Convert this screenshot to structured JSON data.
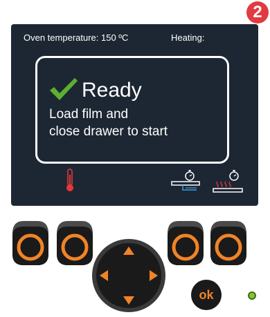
{
  "step_badge": "2",
  "screen": {
    "oven_temperature_label": "Oven temperature: 150 ºC",
    "heating_label": "Heating:",
    "status": {
      "title": "Ready",
      "line1": "Load film and",
      "line2": "close drawer to start"
    },
    "icons": [
      "thermometer-icon",
      "timer-drawer-icon",
      "timer-heating-icon"
    ]
  },
  "controls": {
    "soft_keys": [
      "soft-key-1",
      "soft-key-2",
      "soft-key-3",
      "soft-key-4"
    ],
    "nav_pad": [
      "up-arrow",
      "down-arrow",
      "left-arrow",
      "right-arrow"
    ],
    "ok_label": "ok",
    "led_color": "#86c533"
  },
  "colors": {
    "screen_bg": "#1d2733",
    "accent_orange": "#f08427",
    "check_green": "#5ab031",
    "thermometer_red": "#e53935",
    "badge_red": "#e13a40",
    "icon_blue": "#3aa0e0"
  }
}
